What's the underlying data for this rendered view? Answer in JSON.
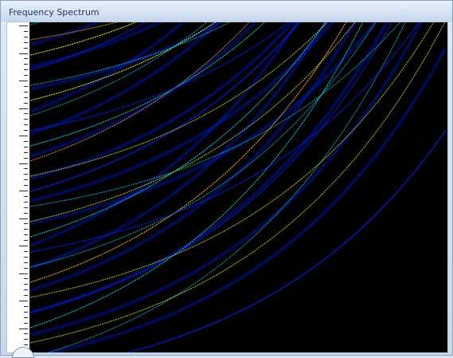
{
  "window": {
    "title": "Frequency Spectrum"
  },
  "spectrum": {
    "colors": {
      "background": "#000000",
      "low": "#0a1fd6",
      "mid": "#11c3d6",
      "high": "#c9e830",
      "peak": "#f2a52c"
    }
  }
}
